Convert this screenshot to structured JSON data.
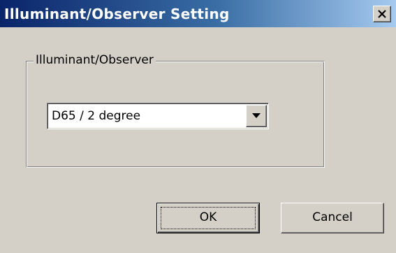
{
  "window": {
    "title": "Illuminant/Observer Setting",
    "close_label": "close"
  },
  "group": {
    "label": "Illuminant/Observer",
    "combo": {
      "selected_value": "D65 / 2 degree"
    }
  },
  "buttons": {
    "ok_label": "OK",
    "cancel_label": "Cancel"
  },
  "colors": {
    "titlebar_start": "#0a246a",
    "titlebar_end": "#a6caf0",
    "dialog_face": "#d4d0c8"
  },
  "icons": {
    "close": "close-icon",
    "dropdown": "chevron-down-icon"
  }
}
